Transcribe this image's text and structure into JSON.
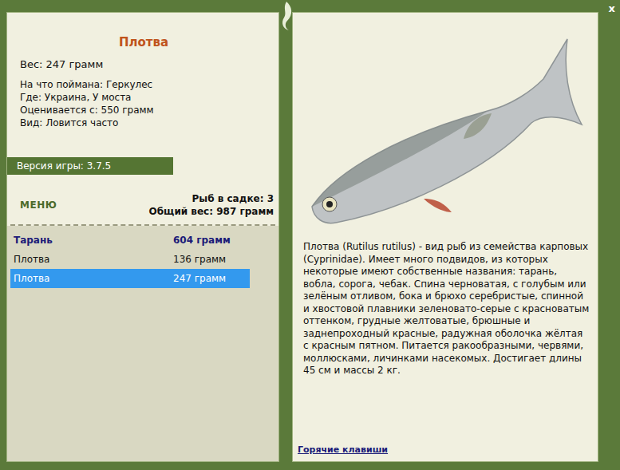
{
  "window": {
    "close": "x"
  },
  "fish_card": {
    "title": "Плотва",
    "weight": "Вес: 247 грамм",
    "details": [
      "На что поймана: Геркулес",
      "Где: Украина, У моста",
      "Оценивается с: 550 грамм",
      "Вид: Ловится часто"
    ]
  },
  "version": "Версия игры: 3.7.5",
  "menu": "МЕНЮ",
  "keepnet": {
    "count": "Рыб в садке: 3",
    "total": "Общий вес: 987 грамм"
  },
  "catch_list": [
    {
      "name": "Тарань",
      "weight": "604 грамм",
      "trophy": true,
      "selected": false
    },
    {
      "name": "Плотва",
      "weight": "136 грамм",
      "trophy": false,
      "selected": false
    },
    {
      "name": "Плотва",
      "weight": "247 грамм",
      "trophy": false,
      "selected": true
    }
  ],
  "description": "Плотва (Rutilus rutilus) - вид рыб из семейства карповых (Cyprinidae). Имеет много подвидов, из которых некоторые имеют собственные названия: тарань, вобла, сорога, чебак. Спина черноватая, с голубым или зелёным отливом, бока и брюхо серебристые, спинной и хвостовой плавники зеленовато-серые с красноватым оттенком, грудные желтоватые, брюшные и заднепроходный красные, радужная оболочка жёлтая с красным пятном. Питается ракообразными, червями, моллюсками, личинками насекомых. Достигает длины 45 см и массы 2 кг.",
  "hotkeys": "Горячие клавиши"
}
